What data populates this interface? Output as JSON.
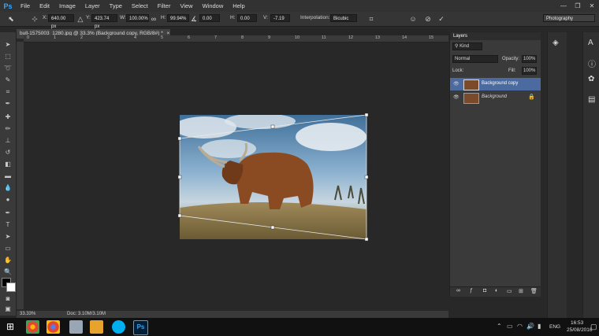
{
  "app_logo": "Ps",
  "menu": [
    "File",
    "Edit",
    "Image",
    "Layer",
    "Type",
    "Select",
    "Filter",
    "View",
    "Window",
    "Help"
  ],
  "window_controls": {
    "minimize": "—",
    "restore": "❐",
    "close": "✕"
  },
  "options": {
    "x_label": "X:",
    "x_value": "640.00 px",
    "y_label": "Y:",
    "y_value": "423.74 px",
    "w_label": "W:",
    "w_value": "100.00%",
    "h_label": "H:",
    "h_value": "99.94%",
    "angle_value": "0.00",
    "hskew_label": "H:",
    "hskew_value": "0.00",
    "vskew_label": "V:",
    "vskew_value": "-7.19",
    "interp_label": "Interpolation:",
    "interp_value": "Bicubic",
    "workspace": "Photography"
  },
  "document_tab": "bull-1575003_1280.jpg @ 33.3% (Background copy, RGB/8#) *",
  "tab_close": "×",
  "ruler_numbers": [
    "0",
    "1",
    "2",
    "3",
    "4",
    "5",
    "6",
    "7",
    "8",
    "9",
    "10",
    "11",
    "12",
    "13",
    "14",
    "15"
  ],
  "status": {
    "zoom": "33.33%",
    "doc": "Doc: 3.10M/3.10M"
  },
  "layers_panel": {
    "title": "Layers",
    "kind_filter": "Kind",
    "blend_mode": "Normal",
    "opacity_label": "Opacity:",
    "opacity_value": "100%",
    "lock_label": "Lock:",
    "fill_label": "Fill:",
    "fill_value": "100%",
    "layers": [
      {
        "name": "Background copy",
        "selected": true
      },
      {
        "name": "Background",
        "selected": false,
        "locked": true
      }
    ]
  },
  "taskbar": {
    "lang": "ENG",
    "time": "16:53",
    "date": "25/08/2016"
  },
  "colors": {
    "selection": "#4b6aa0",
    "ps_blue": "#31a8ff"
  }
}
